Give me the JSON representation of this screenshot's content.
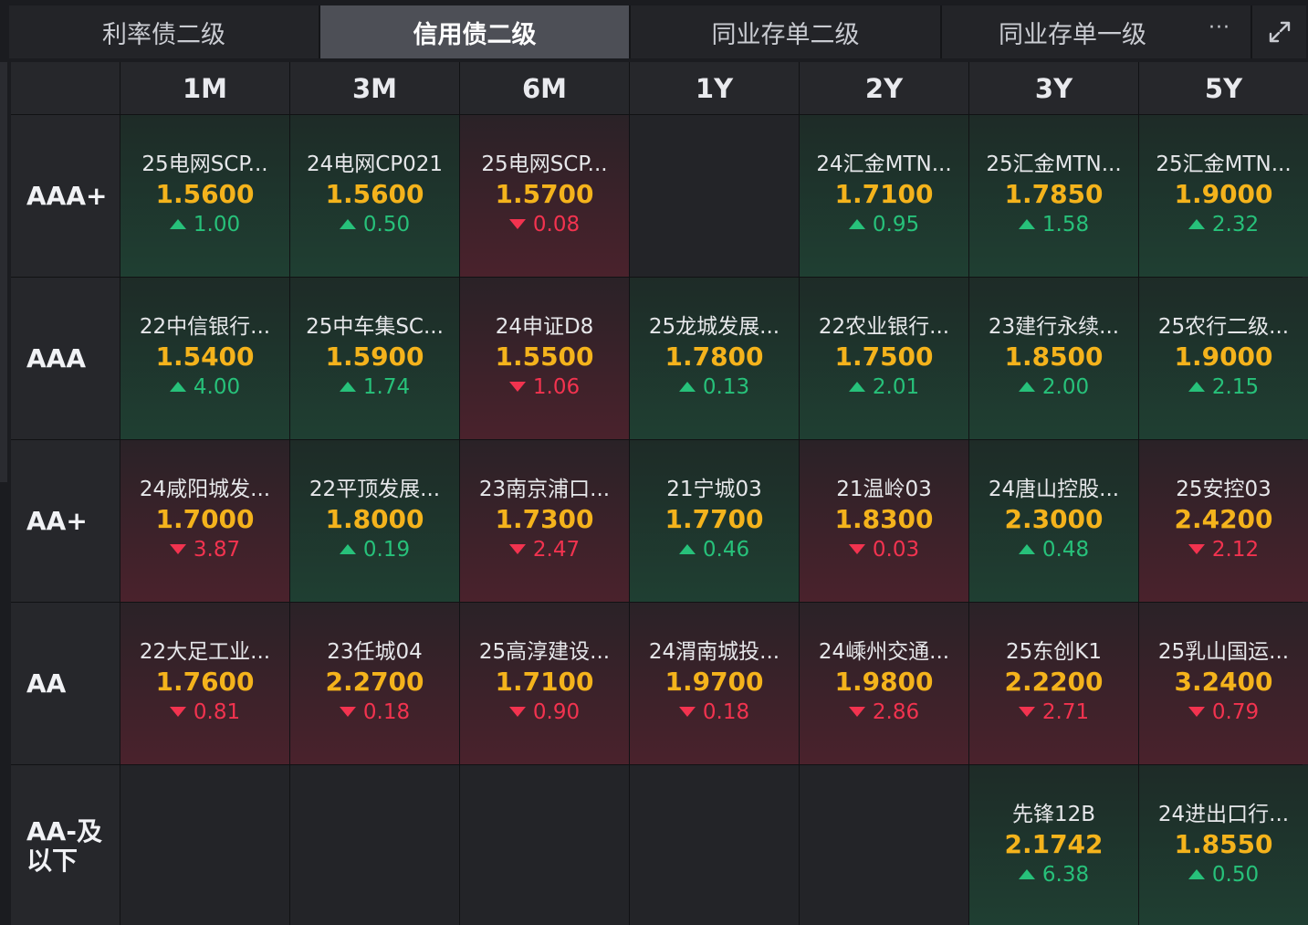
{
  "tabs": [
    {
      "label": "利率债二级",
      "active": false
    },
    {
      "label": "信用债二级",
      "active": true
    },
    {
      "label": "同业存单二级",
      "active": false
    },
    {
      "label": "同业存单一级",
      "active": false
    }
  ],
  "tab_more": "···",
  "columns": [
    "1M",
    "3M",
    "6M",
    "1Y",
    "2Y",
    "3Y",
    "5Y"
  ],
  "rows": [
    {
      "rating": "AAA+",
      "cells": [
        {
          "name": "25电网SCP...",
          "yield": "1.5600",
          "change": "1.00",
          "dir": "up"
        },
        {
          "name": "24电网CP021",
          "yield": "1.5600",
          "change": "0.50",
          "dir": "up"
        },
        {
          "name": "25电网SCP...",
          "yield": "1.5700",
          "change": "0.08",
          "dir": "down"
        },
        null,
        {
          "name": "24汇金MTN...",
          "yield": "1.7100",
          "change": "0.95",
          "dir": "up"
        },
        {
          "name": "25汇金MTN...",
          "yield": "1.7850",
          "change": "1.58",
          "dir": "up"
        },
        {
          "name": "25汇金MTN...",
          "yield": "1.9000",
          "change": "2.32",
          "dir": "up"
        }
      ]
    },
    {
      "rating": "AAA",
      "cells": [
        {
          "name": "22中信银行...",
          "yield": "1.5400",
          "change": "4.00",
          "dir": "up"
        },
        {
          "name": "25中车集SC...",
          "yield": "1.5900",
          "change": "1.74",
          "dir": "up"
        },
        {
          "name": "24申证D8",
          "yield": "1.5500",
          "change": "1.06",
          "dir": "down"
        },
        {
          "name": "25龙城发展...",
          "yield": "1.7800",
          "change": "0.13",
          "dir": "up"
        },
        {
          "name": "22农业银行...",
          "yield": "1.7500",
          "change": "2.01",
          "dir": "up"
        },
        {
          "name": "23建行永续...",
          "yield": "1.8500",
          "change": "2.00",
          "dir": "up"
        },
        {
          "name": "25农行二级...",
          "yield": "1.9000",
          "change": "2.15",
          "dir": "up"
        }
      ]
    },
    {
      "rating": "AA+",
      "cells": [
        {
          "name": "24咸阳城发...",
          "yield": "1.7000",
          "change": "3.87",
          "dir": "down"
        },
        {
          "name": "22平顶发展...",
          "yield": "1.8000",
          "change": "0.19",
          "dir": "up"
        },
        {
          "name": "23南京浦口...",
          "yield": "1.7300",
          "change": "2.47",
          "dir": "down"
        },
        {
          "name": "21宁城03",
          "yield": "1.7700",
          "change": "0.46",
          "dir": "up"
        },
        {
          "name": "21温岭03",
          "yield": "1.8300",
          "change": "0.03",
          "dir": "down"
        },
        {
          "name": "24唐山控股...",
          "yield": "2.3000",
          "change": "0.48",
          "dir": "up"
        },
        {
          "name": "25安控03",
          "yield": "2.4200",
          "change": "2.12",
          "dir": "down"
        }
      ]
    },
    {
      "rating": "AA",
      "cells": [
        {
          "name": "22大足工业...",
          "yield": "1.7600",
          "change": "0.81",
          "dir": "down"
        },
        {
          "name": "23任城04",
          "yield": "2.2700",
          "change": "0.18",
          "dir": "down"
        },
        {
          "name": "25高淳建设...",
          "yield": "1.7100",
          "change": "0.90",
          "dir": "down"
        },
        {
          "name": "24渭南城投...",
          "yield": "1.9700",
          "change": "0.18",
          "dir": "down"
        },
        {
          "name": "24嵊州交通...",
          "yield": "1.9800",
          "change": "2.86",
          "dir": "down"
        },
        {
          "name": "25东创K1",
          "yield": "2.2200",
          "change": "2.71",
          "dir": "down"
        },
        {
          "name": "25乳山国运...",
          "yield": "3.2400",
          "change": "0.79",
          "dir": "down"
        }
      ]
    },
    {
      "rating": "AA-及以下",
      "rating_lines": [
        "AA-及",
        "以下"
      ],
      "cells": [
        null,
        null,
        null,
        null,
        null,
        {
          "name": "先锋12B",
          "yield": "2.1742",
          "change": "6.38",
          "dir": "up"
        },
        {
          "name": "24进出口行...",
          "yield": "1.8550",
          "change": "0.50",
          "dir": "up"
        }
      ]
    }
  ],
  "colors": {
    "up": "#27c17a",
    "down": "#f2334f",
    "yield": "#f4b31c"
  }
}
